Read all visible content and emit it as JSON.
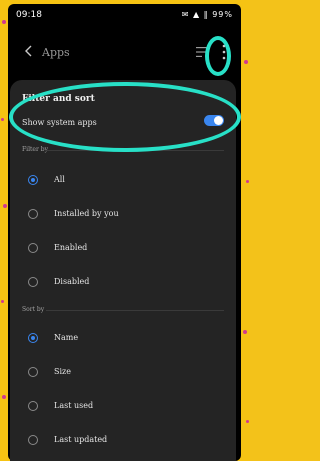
{
  "status_bar": {
    "time": "09:18",
    "icons": "✉ ▲ ‖ 99%"
  },
  "app_bar": {
    "title": "Apps"
  },
  "sheet": {
    "title": "Filter and sort",
    "show_system_apps_label": "Show system apps",
    "show_system_apps_on": true,
    "filter_by_label": "Filter by",
    "filter_options": [
      {
        "label": "All",
        "selected": true
      },
      {
        "label": "Installed by you",
        "selected": false
      },
      {
        "label": "Enabled",
        "selected": false
      },
      {
        "label": "Disabled",
        "selected": false
      }
    ],
    "sort_by_label": "Sort by",
    "sort_options": [
      {
        "label": "Name",
        "selected": true
      },
      {
        "label": "Size",
        "selected": false
      },
      {
        "label": "Last used",
        "selected": false
      },
      {
        "label": "Last updated",
        "selected": false
      }
    ]
  },
  "colors": {
    "accent": "#3a86ef",
    "annotation": "#28e0c7",
    "background": "#f6c313",
    "dots": "#d2398e"
  }
}
